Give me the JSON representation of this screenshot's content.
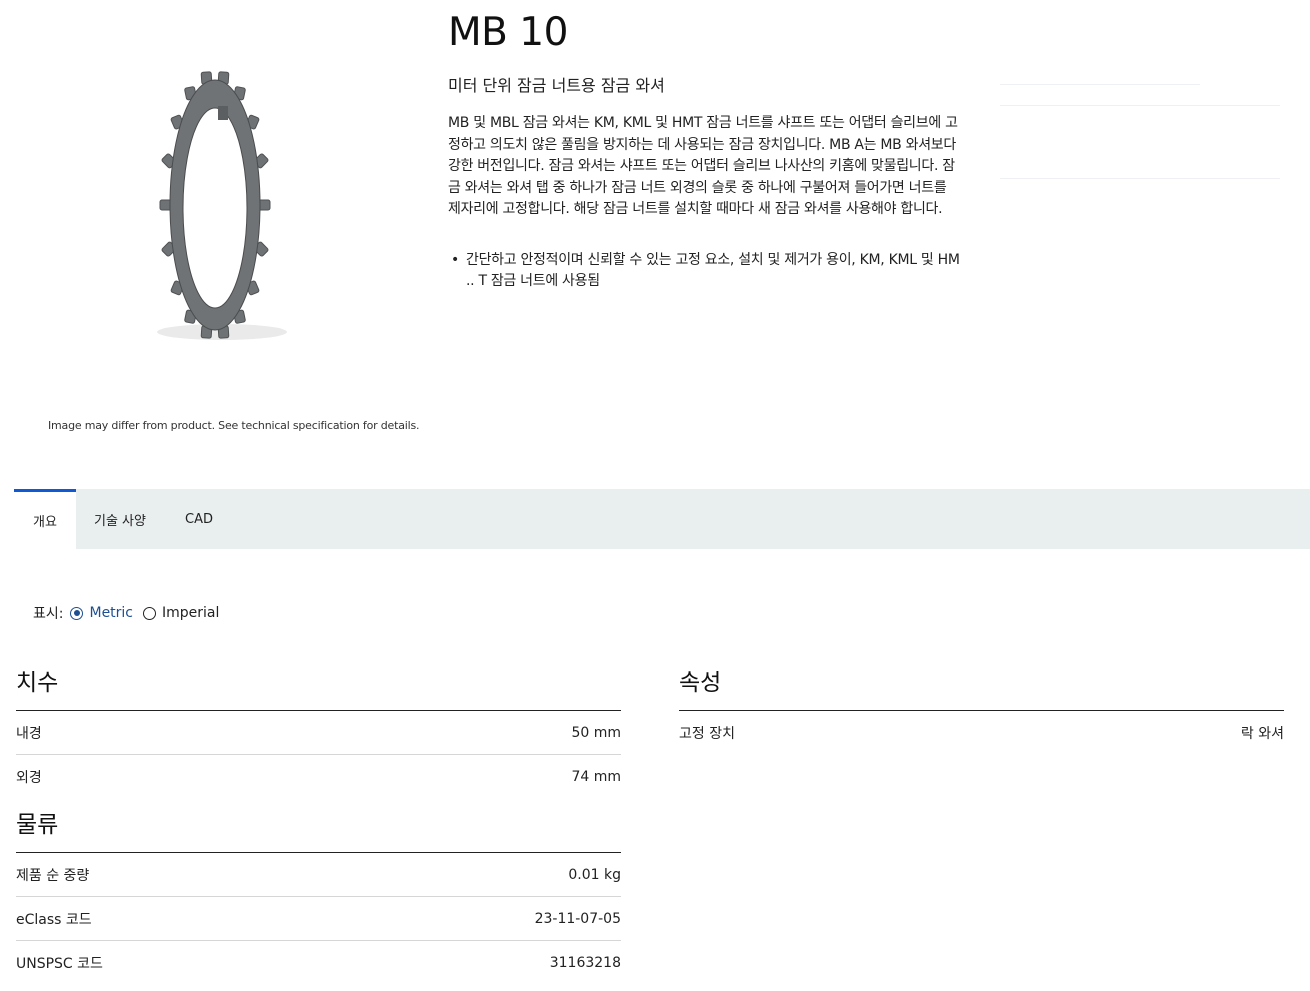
{
  "product": {
    "title": "MB 10",
    "subtitle": "미터 단위 잠금 너트용 잠금 와셔",
    "description": "MB 및 MBL 잠금 와셔는 KM, KML 및 HMT 잠금 너트를 샤프트 또는 어댑터 슬리브에 고정하고 의도치 않은 풀림을 방지하는 데 사용되는 잠금 장치입니다. MB A는 MB 와셔보다 강한 버전입니다. 잠금 와셔는 샤프트 또는 어댑터 슬리브 나사산의 키홈에 맞물립니다. 잠금 와셔는 와셔 탭 중 하나가 잠금 너트 외경의 슬롯 중 하나에 구불어져 들어가면 너트를 제자리에 고정합니다. 해당 잠금 너트를 설치할 때마다 새 잠금 와셔를 사용해야 합니다.",
    "bullets": [
      "간단하고 안정적이며 신뢰할 수 있는 고정 요소, 설치 및 제거가 용이, KM, KML 및 HM .. T 잠금 너트에 사용됨"
    ],
    "image_note": "Image may differ from product. See technical specification for details."
  },
  "tabs": [
    "개요",
    "기술 사양",
    "CAD"
  ],
  "units": {
    "label": "표시:",
    "options": [
      "Metric",
      "Imperial"
    ],
    "selected": "Metric"
  },
  "dimensions": {
    "heading": "치수",
    "rows": [
      {
        "label": "내경",
        "value": "50 mm"
      },
      {
        "label": "외경",
        "value": "74 mm"
      }
    ]
  },
  "logistics": {
    "heading": "물류",
    "rows": [
      {
        "label": "제품 순 중량",
        "value": "0.01 kg"
      },
      {
        "label": "eClass 코드",
        "value": "23-11-07-05"
      },
      {
        "label": "UNSPSC 코드",
        "value": "31163218"
      }
    ]
  },
  "properties": {
    "heading": "속성",
    "rows": [
      {
        "label": "고정 장치",
        "value": "락 와셔"
      }
    ]
  },
  "colors": {
    "accent": "#0f58d6",
    "radio": "#1d4f91",
    "tab_bar": "#e9eeef",
    "washer": "#6f7275"
  }
}
